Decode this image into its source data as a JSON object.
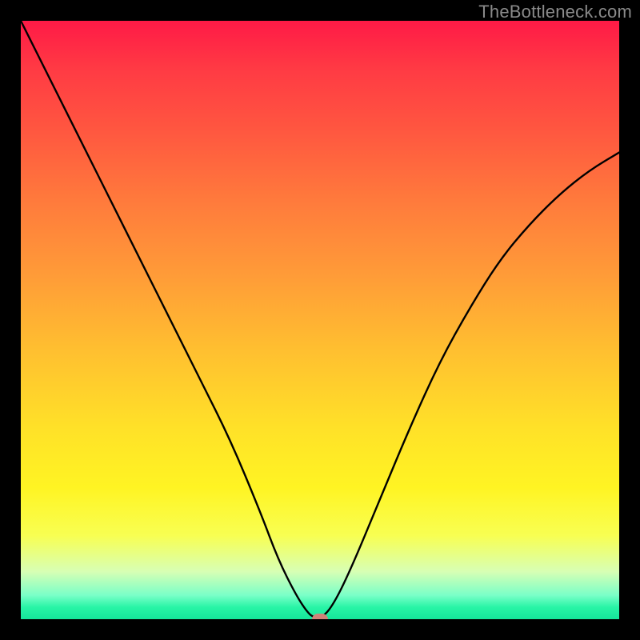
{
  "watermark": "TheBottleneck.com",
  "chart_data": {
    "type": "line",
    "title": "",
    "xlabel": "",
    "ylabel": "",
    "xlim": [
      0,
      100
    ],
    "ylim": [
      0,
      100
    ],
    "grid": false,
    "legend": false,
    "background": "red-to-green vertical gradient (top=100, bottom=0)",
    "series": [
      {
        "name": "curve",
        "color": "#000000",
        "x": [
          0,
          5,
          10,
          15,
          20,
          25,
          30,
          35,
          40,
          43,
          46,
          48,
          49,
          50,
          52,
          55,
          60,
          65,
          70,
          75,
          80,
          85,
          90,
          95,
          100
        ],
        "values": [
          100,
          90,
          80,
          70,
          60,
          50,
          40,
          30,
          18,
          10,
          4,
          1,
          0.3,
          0,
          2,
          8,
          20,
          32,
          43,
          52,
          60,
          66,
          71,
          75,
          78
        ]
      }
    ],
    "marker": {
      "x": 50,
      "y": 0,
      "color": "#cf8378"
    },
    "gradient_stops": [
      {
        "pos": 0,
        "color": "#ff1a46"
      },
      {
        "pos": 30,
        "color": "#ff7a3c"
      },
      {
        "pos": 55,
        "color": "#ffbf30"
      },
      {
        "pos": 78,
        "color": "#fff423"
      },
      {
        "pos": 92,
        "color": "#d8ffb4"
      },
      {
        "pos": 100,
        "color": "#15e69a"
      }
    ]
  }
}
